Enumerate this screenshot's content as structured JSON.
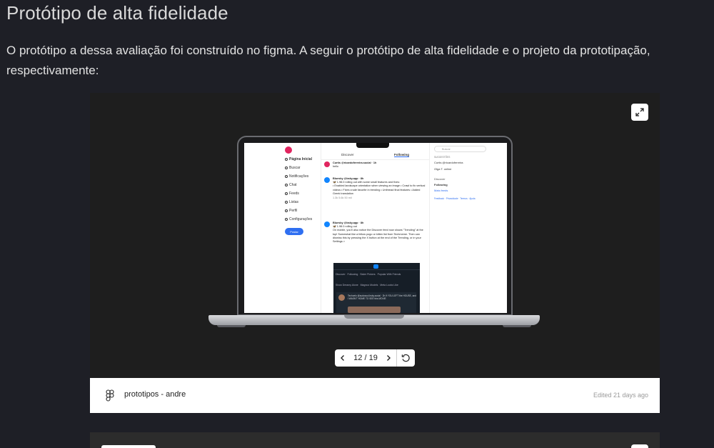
{
  "section": {
    "title": "Protótipo de alta fidelidade",
    "intro": "O protótipo a dessa avaliação foi construído no figma. A seguir o protótipo de alta fidelidade e o projeto da prototipação, respectivamente:"
  },
  "embed": {
    "file_name": "prototipos - andre",
    "edited": "Edited 21 days ago",
    "pager": {
      "current": 12,
      "total": 19,
      "label": "12 / 19"
    },
    "colors": {
      "canvas": "#1e1e1e",
      "footer": "#ffffff",
      "accent": "#2f6ff1",
      "pink": "#e0245e"
    }
  },
  "mockup": {
    "nav": [
      "Página Inicial",
      "Buscar",
      "Notificações",
      "Chat",
      "Feeds",
      "Listas",
      "Perfil",
      "Configurações"
    ],
    "post_button": "Postar",
    "tabs": {
      "discover": "Discover",
      "following": "Following"
    },
    "posts": [
      {
        "author": "Curtis @ricardoferreira.social · 1h",
        "text": "hello",
        "actions": ""
      },
      {
        "author": "Bluesky @bsky.app · 8h",
        "text": "🦋 1.98.0 rolling out with some small features and fixes:",
        "list": "• Enabled landscape orientation when viewing an image  • Crawl to fix vertical videos  • Fixes crude favorite in trending  • Unthread final features  • Added Greek translation",
        "actions": "1.3k   5.6k   50 mil"
      },
      {
        "author": "Bluesky @bsky.app · 8h",
        "text": "🦋 1.98.0 rolling out",
        "list": "On mobile, you'll also notice the Discover feed now shows \"Trending\" at the top! Somewhat like a fellow pogo or kitten list from Techmeme. Then can dismiss this by pressing the X button at the end of the Trending, or in your Settings >",
        "actions": ""
      }
    ],
    "embed_tabs": [
      "Discover",
      "Following",
      "Sister Pickers",
      "Popular With Friends"
    ],
    "embed_tabs2": [
      "Show Dreamy Alone",
      "Magnus Models",
      "Meta Looks Like"
    ],
    "embed_post": "Techoelo @sudosoul.bsky.social · 2h\nIf YOU LEFT the HOUSE, and I WASN'T HOME TO SEE this MOVIE",
    "search_placeholder": "Buscar",
    "right": {
      "header": "SUGGESTÕES",
      "users": [
        "Curtis @ricardoferreira",
        "Olga T. online"
      ],
      "discover": "Discover",
      "following": "Following",
      "more": "Mais feeds",
      "links": "Feedback · Privacidade · Termos · Ajuda"
    }
  }
}
